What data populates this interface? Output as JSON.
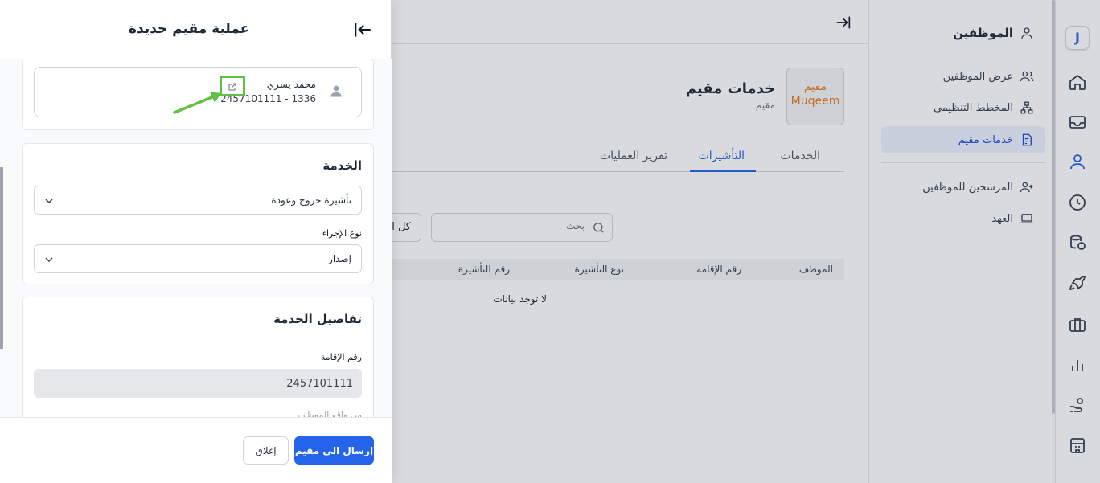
{
  "colors": {
    "accent": "#2563eb",
    "annotation": "#62c046",
    "muqeem_brand": "#e67e22"
  },
  "rail": {
    "logo_letter": "J",
    "icons": [
      "home-icon",
      "inbox-icon",
      "user-icon",
      "clock-icon",
      "database-icon",
      "rocket-icon",
      "briefcase-icon",
      "chart-icon",
      "hand-coin-icon",
      "building-icon"
    ]
  },
  "subnav": {
    "title": "الموظفين",
    "items": [
      {
        "label": "عرض الموظفين"
      },
      {
        "label": "المخطط التنظيمي"
      },
      {
        "label": "خدمات مقيم"
      },
      {
        "label": "المرشحين للموظفين"
      },
      {
        "label": "العهد"
      }
    ]
  },
  "page": {
    "logo_line1": "مقيم",
    "logo_line2": "Muqeem",
    "title": "خدمات مقيم",
    "subtitle": "مقيم",
    "tabs": [
      {
        "label": "الخدمات"
      },
      {
        "label": "التأشيرات"
      },
      {
        "label": "تقرير العمليات"
      }
    ],
    "search_placeholder": "بحث",
    "filter_value": "كل التأشيرات",
    "table": {
      "headers": [
        "الموظف",
        "رقم الإقامة",
        "نوع التأشيرة",
        "رقم التأشيرة"
      ],
      "empty_message": "لا توجد بيانات"
    }
  },
  "drawer": {
    "title": "عملية مقيم جديدة",
    "employee": {
      "name": "محمد يسري",
      "details": "2457101111 - 1336"
    },
    "service": {
      "section_title": "الخدمة",
      "selected_service": "تأشيرة خروج وعودة",
      "procedure_label": "نوع الإجراء",
      "procedure_value": "إصدار"
    },
    "details": {
      "section_title": "تفاصيل الخدمة",
      "iqama_label": "رقم الإقامة",
      "iqama_value": "2457101111",
      "next_label": "من واقع الموظف"
    },
    "footer": {
      "submit_label": "إرسال الى مقيم",
      "close_label": "إغلاق"
    }
  }
}
